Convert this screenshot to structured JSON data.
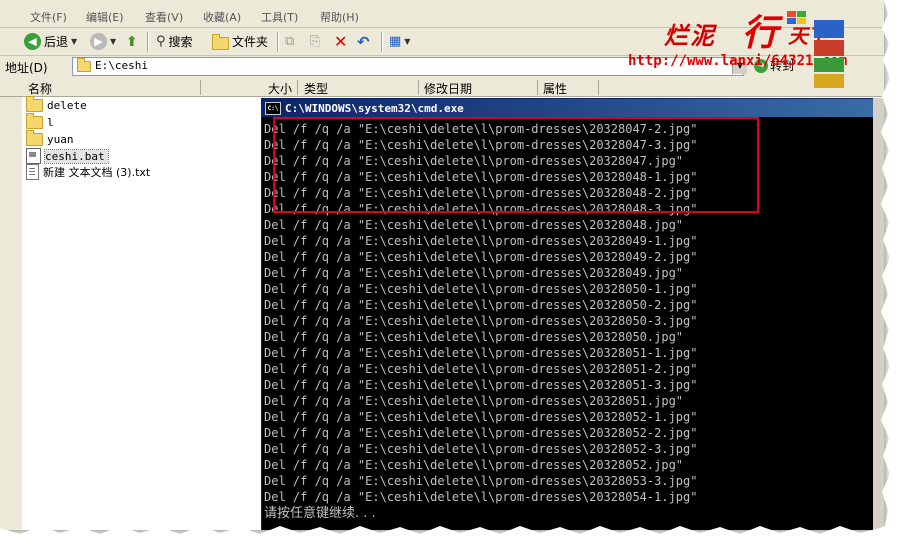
{
  "menu": [
    "文件(F)",
    "编辑(E)",
    "查看(V)",
    "收藏(A)",
    "工具(T)",
    "帮助(H)"
  ],
  "toolbar": {
    "back_label": "后退",
    "search_label": "搜索",
    "folders_label": "文件夹"
  },
  "address": {
    "label": "地址(D)",
    "value": "E:\\ceshi",
    "go_label": "转到"
  },
  "columns": {
    "name": "名称",
    "size": "大小",
    "type": "类型",
    "modified": "修改日期",
    "attributes": "属性"
  },
  "files": [
    {
      "name": "delete",
      "kind": "folder"
    },
    {
      "name": "l",
      "kind": "folder"
    },
    {
      "name": "yuan",
      "kind": "folder"
    },
    {
      "name": "ceshi.bat",
      "kind": "bat"
    },
    {
      "name": "新建 文本文档 (3).txt",
      "kind": "txt"
    }
  ],
  "logo": {
    "text1": "烂泥",
    "text2": "行",
    "text3": "天下",
    "url": "http://www.lanxi/64321.com"
  },
  "cmd": {
    "title": "C:\\WINDOWS\\system32\\cmd.exe",
    "lines": [
      "Del /f /q /a \"E:\\ceshi\\delete\\l\\prom-dresses\\20328047-2.jpg\"",
      "Del /f /q /a \"E:\\ceshi\\delete\\l\\prom-dresses\\20328047-3.jpg\"",
      "Del /f /q /a \"E:\\ceshi\\delete\\l\\prom-dresses\\20328047.jpg\"",
      "Del /f /q /a \"E:\\ceshi\\delete\\l\\prom-dresses\\20328048-1.jpg\"",
      "Del /f /q /a \"E:\\ceshi\\delete\\l\\prom-dresses\\20328048-2.jpg\"",
      "Del /f /q /a \"E:\\ceshi\\delete\\l\\prom-dresses\\20328048-3.jpg\"",
      "Del /f /q /a \"E:\\ceshi\\delete\\l\\prom-dresses\\20328048.jpg\"",
      "Del /f /q /a \"E:\\ceshi\\delete\\l\\prom-dresses\\20328049-1.jpg\"",
      "Del /f /q /a \"E:\\ceshi\\delete\\l\\prom-dresses\\20328049-2.jpg\"",
      "Del /f /q /a \"E:\\ceshi\\delete\\l\\prom-dresses\\20328049.jpg\"",
      "Del /f /q /a \"E:\\ceshi\\delete\\l\\prom-dresses\\20328050-1.jpg\"",
      "Del /f /q /a \"E:\\ceshi\\delete\\l\\prom-dresses\\20328050-2.jpg\"",
      "Del /f /q /a \"E:\\ceshi\\delete\\l\\prom-dresses\\20328050-3.jpg\"",
      "Del /f /q /a \"E:\\ceshi\\delete\\l\\prom-dresses\\20328050.jpg\"",
      "Del /f /q /a \"E:\\ceshi\\delete\\l\\prom-dresses\\20328051-1.jpg\"",
      "Del /f /q /a \"E:\\ceshi\\delete\\l\\prom-dresses\\20328051-2.jpg\"",
      "Del /f /q /a \"E:\\ceshi\\delete\\l\\prom-dresses\\20328051-3.jpg\"",
      "Del /f /q /a \"E:\\ceshi\\delete\\l\\prom-dresses\\20328051.jpg\"",
      "Del /f /q /a \"E:\\ceshi\\delete\\l\\prom-dresses\\20328052-1.jpg\"",
      "Del /f /q /a \"E:\\ceshi\\delete\\l\\prom-dresses\\20328052-2.jpg\"",
      "Del /f /q /a \"E:\\ceshi\\delete\\l\\prom-dresses\\20328052-3.jpg\"",
      "Del /f /q /a \"E:\\ceshi\\delete\\l\\prom-dresses\\20328052.jpg\"",
      "Del /f /q /a \"E:\\ceshi\\delete\\l\\prom-dresses\\20328053-3.jpg\"",
      "Del /f /q /a \"E:\\ceshi\\delete\\l\\prom-dresses\\20328054-1.jpg\""
    ],
    "prompt": "请按任意键继续. . ."
  },
  "colors": {
    "highlight": "#e0001a",
    "titlebar_start": "#0a246a",
    "titlebar_end": "#3a6ea5",
    "logo_red": "#e00000"
  },
  "icons": [
    "back-icon",
    "forward-icon",
    "up-folder-icon",
    "search-icon",
    "folders-icon",
    "move-icon",
    "copy-icon",
    "delete-icon",
    "undo-icon",
    "views-icon",
    "folder-icon",
    "cmd-icon"
  ]
}
